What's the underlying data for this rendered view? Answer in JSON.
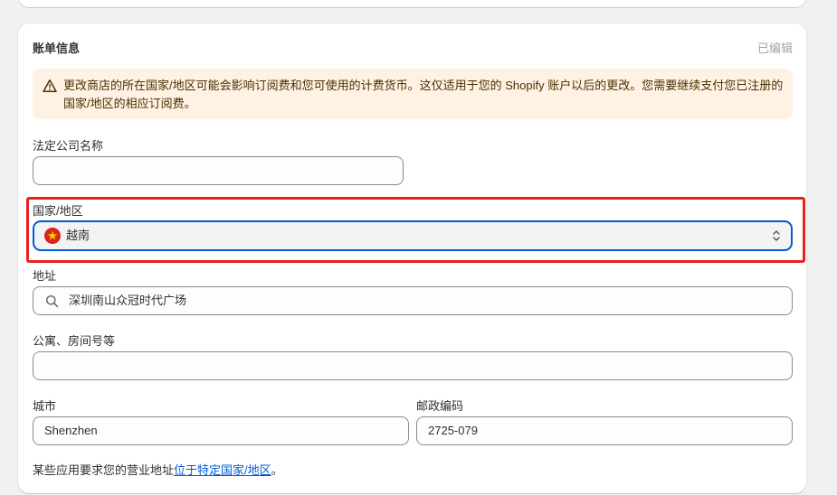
{
  "section": {
    "title": "账单信息",
    "status": "已编辑"
  },
  "banner": {
    "icon": "warning-icon",
    "text": "更改商店的所在国家/地区可能会影响订阅费和您可使用的计费货币。这仅适用于您的 Shopify 账户以后的更改。您需要继续支付您已注册的国家/地区的相应订阅费。"
  },
  "form": {
    "legal_name": {
      "label": "法定公司名称",
      "value": ""
    },
    "country": {
      "label": "国家/地区",
      "value": "越南",
      "flag": "vietnam-flag-icon"
    },
    "address": {
      "label": "地址",
      "value": "深圳南山众冠时代广场"
    },
    "apartment": {
      "label": "公寓、房间号等",
      "value": ""
    },
    "city": {
      "label": "城市",
      "value": "Shenzhen"
    },
    "postal": {
      "label": "邮政编码",
      "value": "2725-079"
    }
  },
  "footer": {
    "prefix": "某些应用要求您的营业地址",
    "link": "位于特定国家/地区",
    "suffix": "。"
  },
  "colors": {
    "accent": "#005bd3",
    "highlight": "#e8231d",
    "banner_bg": "#fff1e3"
  }
}
